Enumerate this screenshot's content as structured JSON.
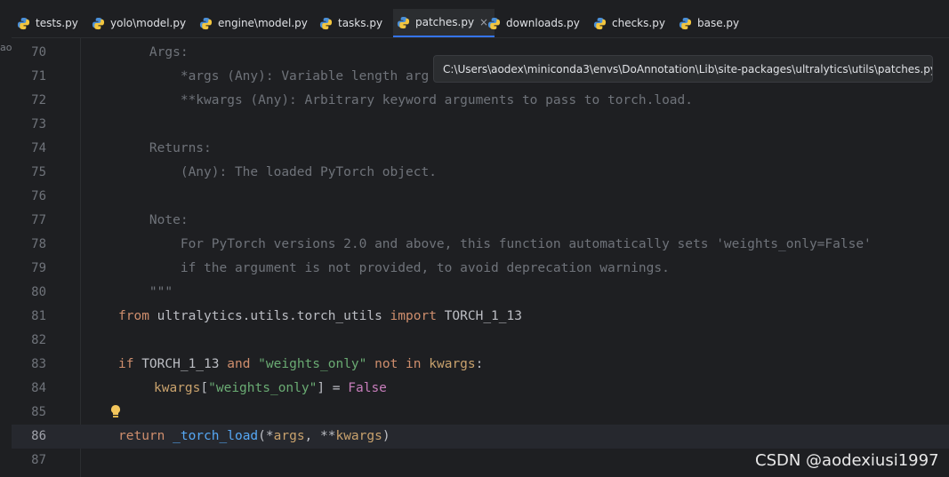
{
  "left_strip_text": "ao",
  "tabs": [
    {
      "label": "tests.py",
      "active": false
    },
    {
      "label": "yolo\\model.py",
      "active": false
    },
    {
      "label": "engine\\model.py",
      "active": false
    },
    {
      "label": "tasks.py",
      "active": false
    },
    {
      "label": "patches.py",
      "active": true
    },
    {
      "label": "downloads.py",
      "active": false
    },
    {
      "label": "checks.py",
      "active": false
    },
    {
      "label": "base.py",
      "active": false
    }
  ],
  "close_glyph": "×",
  "tooltip": "C:\\Users\\aodex\\miniconda3\\envs\\DoAnnotation\\Lib\\site-packages\\ultralytics\\utils\\patches.py",
  "lines": [
    {
      "n": "70",
      "t": "    Args:"
    },
    {
      "n": "71",
      "t": "        *args (Any): Variable length arg"
    },
    {
      "n": "72",
      "t": "        **kwargs (Any): Arbitrary keyword arguments to pass to torch.load."
    },
    {
      "n": "73",
      "t": ""
    },
    {
      "n": "74",
      "t": "    Returns:"
    },
    {
      "n": "75",
      "t": "        (Any): The loaded PyTorch object."
    },
    {
      "n": "76",
      "t": ""
    },
    {
      "n": "77",
      "t": "    Note:"
    },
    {
      "n": "78",
      "t": "        For PyTorch versions 2.0 and above, this function automatically sets 'weights_only=False'"
    },
    {
      "n": "79",
      "t": "        if the argument is not provided, to avoid deprecation warnings."
    },
    {
      "n": "80",
      "t": "    \"\"\""
    },
    {
      "n": "81",
      "a": "from",
      "b": " ultralytics.utils.torch_utils ",
      "c": "import",
      "d": " TORCH_1_13"
    },
    {
      "n": "82",
      "t": ""
    },
    {
      "n": "83",
      "a": "if",
      "b": " TORCH_1_13 ",
      "c": "and",
      "d": " ",
      "e": "\"weights_only\"",
      "f": " ",
      "g": "not in",
      "h": " ",
      "i": "kwargs",
      "j": ":"
    },
    {
      "n": "84",
      "a": "kwargs",
      "b": "[",
      "c": "\"weights_only\"",
      "d": "] = ",
      "e": "False"
    },
    {
      "n": "85",
      "t": ""
    },
    {
      "n": "86",
      "a": "return",
      "b": " _torch_load",
      "c": "(*",
      "d": "args",
      "e": ", **",
      "f": "kwargs",
      "g": ")"
    },
    {
      "n": "87",
      "t": ""
    }
  ],
  "watermark": "CSDN @aodexiusi1997",
  "colors": {
    "background": "#1e1f22",
    "accent": "#3574f0",
    "keyword": "#cf8e6d",
    "string": "#6aab73",
    "docstring": "#6f737a"
  }
}
